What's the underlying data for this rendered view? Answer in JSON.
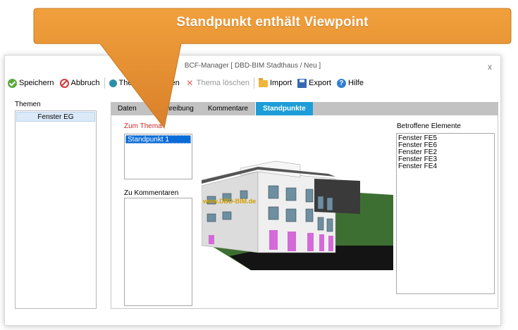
{
  "window": {
    "title": "BCF-Manager [ DBD-BIM Stadthaus / Neu ]",
    "close_label": "x"
  },
  "toolbar": {
    "save": "Speichern",
    "cancel": "Abbruch",
    "attach": "Thema anhängen",
    "delete": "Thema löschen",
    "import": "Import",
    "export": "Export",
    "help": "Hilfe"
  },
  "themes": {
    "label": "Themen",
    "items": [
      "Fenster EG"
    ]
  },
  "tabs": [
    "Daten",
    "Beschreibung",
    "Kommentare",
    "Standpunkte"
  ],
  "active_tab": "Standpunkte",
  "viewpoints": {
    "zum_thema_label": "Zum Thema",
    "zum_thema_items": [
      "Standpunkt 1"
    ],
    "zu_kommentaren_label": "Zu Kommentaren",
    "zu_kommentaren_items": []
  },
  "affected": {
    "label": "Betroffene Elemente",
    "items": [
      "Fenster FE5",
      "Fenster FE6",
      "Fenster FE2",
      "Fenster FE3",
      "Fenster FE4"
    ]
  },
  "model_watermark": "www.DBD-BIM.de",
  "callout": {
    "text": "Standpunkt enthält Viewpoint",
    "color": "#e5922f"
  },
  "colors": {
    "tab_active": "#1e9dd8",
    "selection": "#0a6cd8",
    "label_red": "#cc2b2b",
    "window_accent": "#d36ad8"
  }
}
